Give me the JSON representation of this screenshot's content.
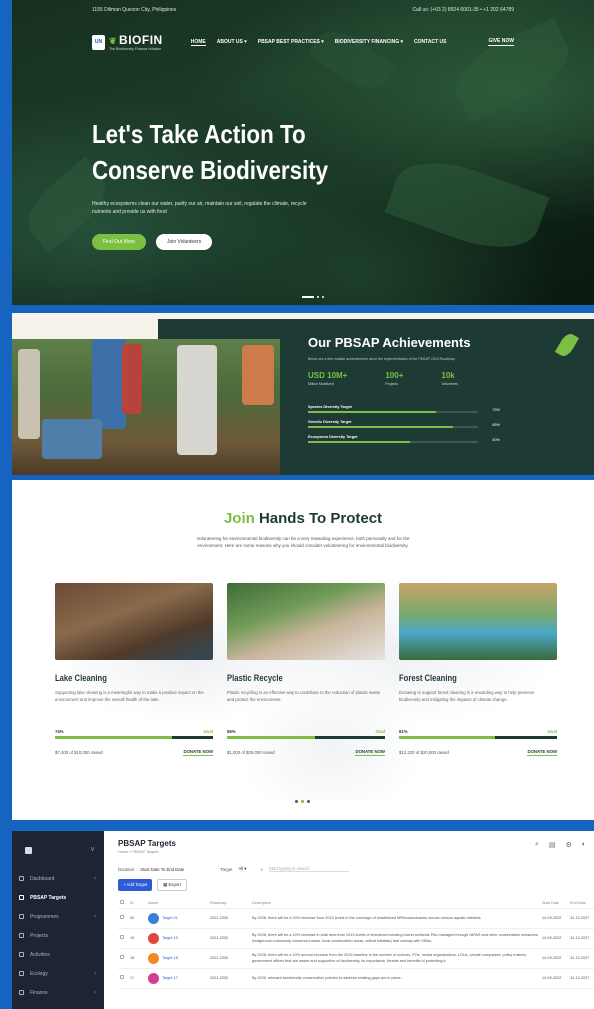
{
  "hero": {
    "address": "1155 Diliman Quezon City, Philippines",
    "contact": "Call us: (+63 2) 8924 6001-35 • +1 202 64789",
    "logo_main": "BIOFIN",
    "logo_sub": "The Biodiversity Finance Initiative",
    "logo_un": "UN",
    "nav": [
      "HOME",
      "ABOUT US ▾",
      "PBSAP BEST PRACTICES ▾",
      "BIODIVERSITY FINANCING ▾",
      "CONTACT US"
    ],
    "give_now": "GIVE NOW",
    "title_line1": "Let's Take Action To",
    "title_line2": "Conserve Biodiversity",
    "description": "Healthy ecosystems clean our water, purify our air, maintain our soil, regulate the climate, recycle nutrients and provide us with food",
    "btn_find": "Find Out More",
    "btn_join": "Join Volunteers"
  },
  "achievements": {
    "title": "Our PBSAP Achievements",
    "subtitle": "Below are a few notable achievements since the implementation of the PBSAP 2024 Roadmap",
    "stats": [
      {
        "value": "USD 10M+",
        "label": "Million Mobilized"
      },
      {
        "value": "100+",
        "label": "Projects"
      },
      {
        "value": "10k",
        "label": "Volunteers"
      }
    ],
    "bars": [
      {
        "label": "Species Diversity Target",
        "pct_text": "75%",
        "pct": 75
      },
      {
        "label": "Genetic Diversity Target",
        "pct_text": "85%",
        "pct": 85
      },
      {
        "label": "Ecosystem Diversity Target",
        "pct_text": "60%",
        "pct": 60
      }
    ]
  },
  "join": {
    "title_green": "Join",
    "title_rest": "Hands To Protect",
    "description": "Volunteering for environmental biodiversity can be a very rewarding experience, both personally and for the environment. Here are some reasons why you should consider volunteering for environmental biodiversity.",
    "cards": [
      {
        "title": "Lake Cleaning",
        "desc": "Supporting lake cleaning is a meaningful way to make a positive impact on the environment and improve the overall health of the lake.",
        "pct_text": "74%",
        "pct": 74,
        "goal": "Goal",
        "raised": "$7,400 of $10,000 raised",
        "donate": "DONATE NOW"
      },
      {
        "title": "Plastic Recycle",
        "desc": "Plastic recycling is an effective way to contribute to the reduction of plastic waste and protect the environment.",
        "pct_text": "56%",
        "pct": 56,
        "goal": "Goal",
        "raised": "$1,000 of $25,000 raised",
        "donate": "DONATE NOW"
      },
      {
        "title": "Forest Cleaning",
        "desc": "Donating to support forest cleaning is a rewarding way to help preserve biodiversity and mitigating the impacts of climate change.",
        "pct_text": "61%",
        "pct": 61,
        "goal": "Goal",
        "raised": "$12,220 of $20,000 raised",
        "donate": "DONATE NOW"
      }
    ]
  },
  "admin": {
    "sidebar": [
      {
        "label": "Dashboard",
        "chev": "›"
      },
      {
        "label": "PBSAP Targets",
        "chev": ""
      },
      {
        "label": "Programmes",
        "chev": "›"
      },
      {
        "label": "Projects",
        "chev": ""
      },
      {
        "label": "Activities",
        "chev": ""
      },
      {
        "label": "Ecology",
        "chev": "›"
      },
      {
        "label": "Finance",
        "chev": "›"
      }
    ],
    "collapse": "∨",
    "title": "PBSAP Targets",
    "breadcrumb": "Home > PBSAP Targets",
    "filter_duration": "Duration",
    "filter_dates": "Start Date To End Date",
    "filter_target": "Target",
    "filter_all": "All ▾",
    "search_placeholder": "Start typing to search",
    "btn_add": "+ Add Target",
    "btn_export": "Export",
    "columns": [
      "ID",
      "Name",
      "Roadmap",
      "Description",
      "Start Date",
      "End Date"
    ],
    "rows": [
      {
        "id": "20",
        "name": "Target 01",
        "roadmap": "2021-2030",
        "desc": "By 2028, there will be a 20% increase from 2015 levels in the coverage of established MPAs/sanctuaries across various aquatic habitats.",
        "start": "14-09-2022",
        "end": "31-12-2027",
        "color": "#3b7dd8"
      },
      {
        "id": "19",
        "name": "Target 19",
        "roadmap": "2021-2030",
        "desc": "By 2028, there will be a 10% increase in total area from 2015 levels of terrestrial including inland wetlands PAs managed through NIPAS and other conservation measures (indigenous community conserved areas, local conservation areas, critical habitats) that overlap with KBAs.",
        "start": "14-09-2022",
        "end": "31-12-2027",
        "color": "#e0483e"
      },
      {
        "id": "18",
        "name": "Target 18",
        "roadmap": "2021-2030",
        "desc": "By 2028, there will be a 10% annual increase from the 2015 baseline in the number of schools, POs, media organizations, LGUs, private companies, policy makers, government offices that are aware and supportive of biodiversity, its importance, threats and benefits of protecting it.",
        "start": "14-09-2022",
        "end": "31-12-2027",
        "color": "#f08a24"
      },
      {
        "id": "17",
        "name": "Target 17",
        "roadmap": "2021-2030",
        "desc": "By 2025, relevant biodiversity conservation policies to address existing gaps are in place.",
        "start": "14-09-2022",
        "end": "31-12-2027",
        "color": "#d63c8f"
      }
    ]
  }
}
